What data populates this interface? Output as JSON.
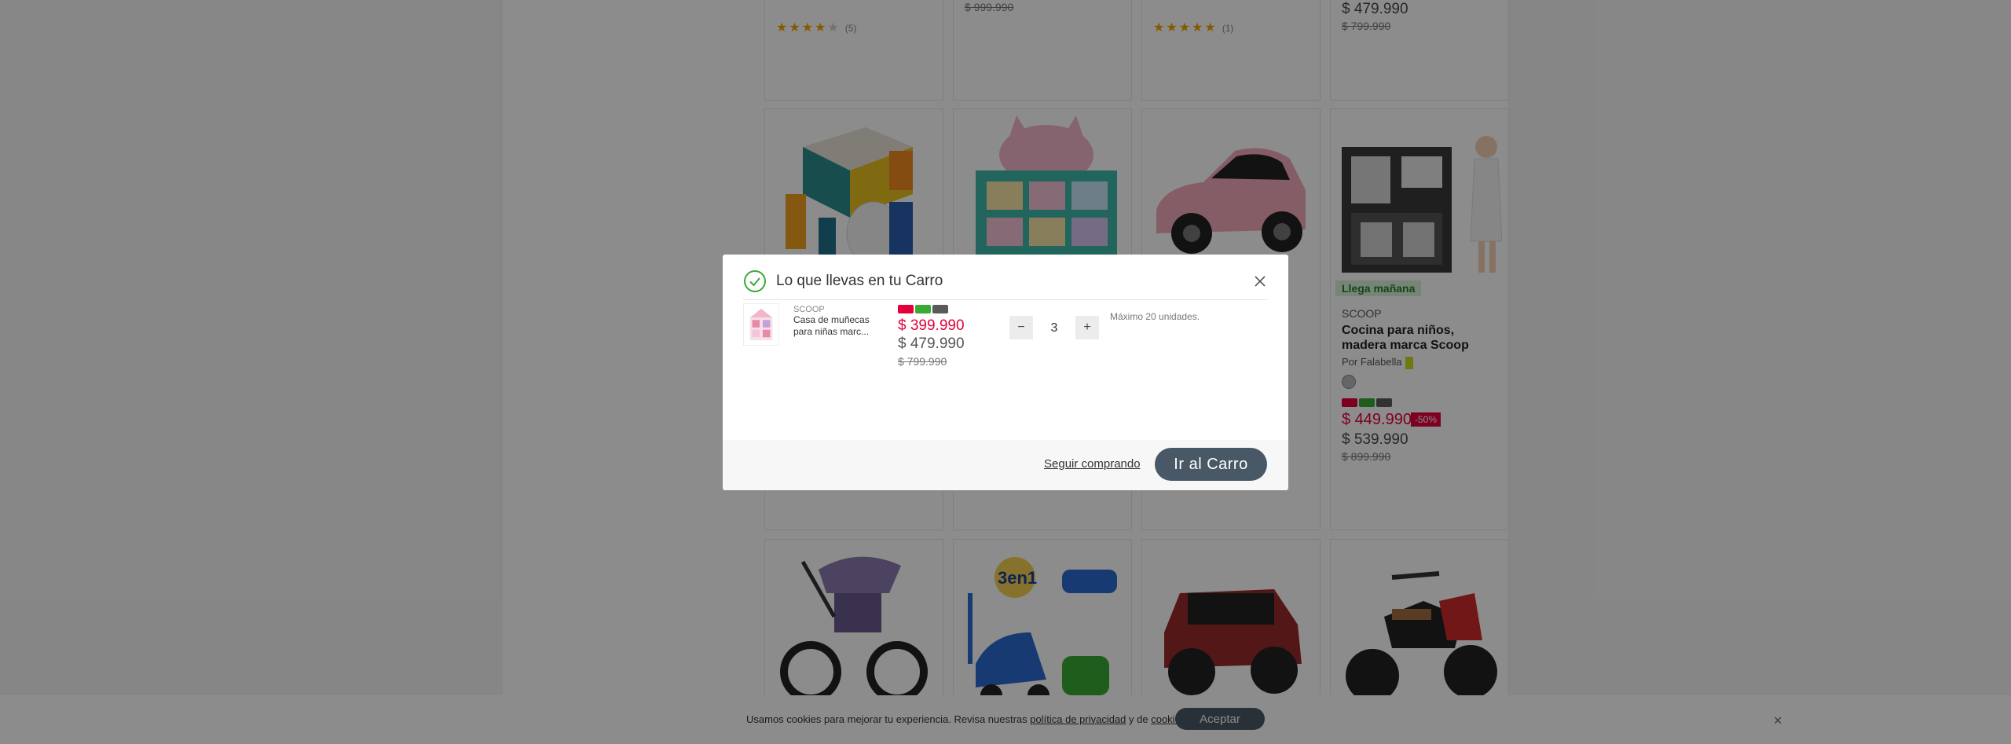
{
  "grid": {
    "row1": {
      "card1": {
        "stars_filled": 4,
        "stars_total": 5,
        "review_count": "(5)"
      },
      "card2": {
        "old_price": "$ 999.990"
      },
      "card3": {
        "stars_filled": 5,
        "stars_total": 5,
        "review_count": "(1)"
      },
      "card4": {
        "price": "$ 479.990",
        "old_price": "$ 799.990"
      }
    },
    "row2": {
      "card4": {
        "badge": "Llega mañana",
        "brand": "SCOOP",
        "name": "Cocina para niños, madera marca Scoop",
        "seller": "Por Falabella",
        "price": "$ 449.990",
        "discount": "-50%",
        "price2": "$ 539.990",
        "old_price": "$ 899.990"
      }
    }
  },
  "modal": {
    "title": "Lo que llevas en tu Carro",
    "item": {
      "brand": "SCOOP",
      "name": "Casa de muñecas para niñas marc...",
      "price": "$ 399.990",
      "price2": "$ 479.990",
      "old_price": "$ 799.990",
      "quantity": "3",
      "max_note": "Máximo 20 unidades.",
      "minus_label": "−",
      "plus_label": "+"
    },
    "continue_label": "Seguir comprando",
    "cart_button_label": "Ir al Carro"
  },
  "cookie_bar": {
    "text_before": "Usamos cookies para mejorar tu experiencia. Revisa nuestras ",
    "privacy_link": "política de privacidad",
    "text_middle": " y de ",
    "cookies_link": "cookies",
    "text_after": ".",
    "accept_label": "Aceptar",
    "close_label": "×"
  },
  "colors": {
    "accent_red": "#e4003b",
    "button_dark": "#495867",
    "success_green": "#3aaa35"
  }
}
